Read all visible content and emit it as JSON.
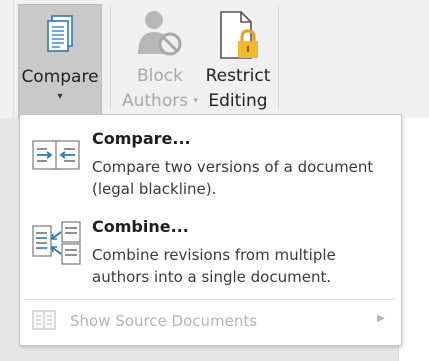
{
  "ribbon": {
    "compare": {
      "label": "Compare",
      "caret": "▾",
      "icon": "compare-document-icon"
    },
    "block_authors": {
      "line1": "Block",
      "line2": "Authors",
      "caret": "▾",
      "icon": "block-authors-icon"
    },
    "restrict_editing": {
      "line1": "Restrict",
      "line2": "Editing",
      "icon": "restrict-editing-icon"
    }
  },
  "menu": {
    "compare": {
      "title": "Compare...",
      "description": "Compare two versions of a document (legal blackline).",
      "icon": "compare-versions-icon"
    },
    "combine": {
      "title": "Combine...",
      "description": "Combine revisions from multiple authors into a single document.",
      "icon": "combine-revisions-icon"
    },
    "show_source": {
      "label": "Show Source Documents",
      "icon": "source-documents-icon",
      "submenu_arrow": "▶"
    }
  },
  "colors": {
    "accent_blue": "#2b78c5",
    "disabled_text": "#b4b4b4",
    "pressed_button": "#c9c9c9"
  }
}
